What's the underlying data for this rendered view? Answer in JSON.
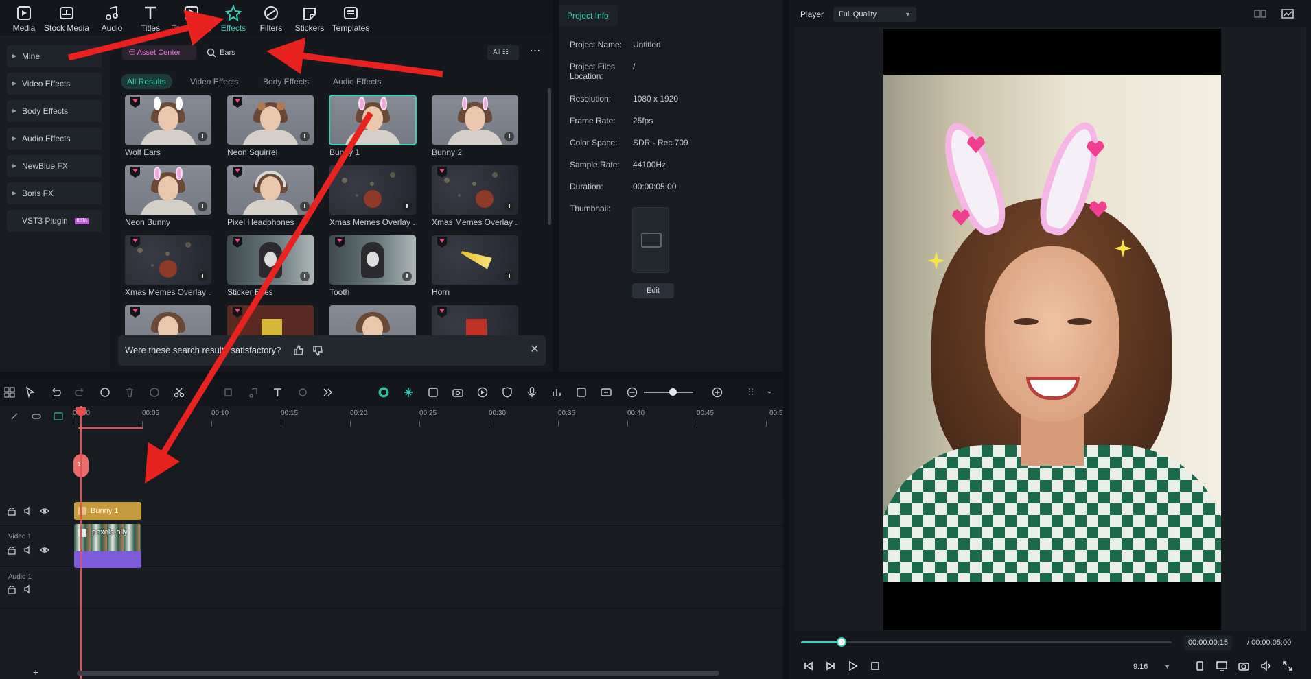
{
  "toolbar": {
    "items": [
      {
        "label": "Media",
        "icon": "media-icon"
      },
      {
        "label": "Stock Media",
        "icon": "stock-media-icon"
      },
      {
        "label": "Audio",
        "icon": "audio-icon"
      },
      {
        "label": "Titles",
        "icon": "titles-icon"
      },
      {
        "label": "Transitions",
        "icon": "transitions-icon"
      },
      {
        "label": "Effects",
        "icon": "effects-icon",
        "active": true
      },
      {
        "label": "Filters",
        "icon": "filters-icon"
      },
      {
        "label": "Stickers",
        "icon": "stickers-icon"
      },
      {
        "label": "Templates",
        "icon": "templates-icon"
      }
    ]
  },
  "sidebar": {
    "items": [
      {
        "label": "Mine"
      },
      {
        "label": "Video Effects"
      },
      {
        "label": "Body Effects"
      },
      {
        "label": "Audio Effects"
      },
      {
        "label": "NewBlue FX"
      },
      {
        "label": "Boris FX"
      },
      {
        "label": "VST3 Plugin",
        "badge": "BETA"
      }
    ]
  },
  "browser": {
    "asset_center_label": "Asset Center",
    "search_value": "Ears",
    "filter_label": "All",
    "result_tabs": [
      "All Results",
      "Video Effects",
      "Body Effects",
      "Audio Effects"
    ],
    "active_tab": "All Results",
    "items": [
      {
        "name": "Wolf Ears",
        "selected": false
      },
      {
        "name": "Neon Squirrel",
        "selected": false
      },
      {
        "name": "Bunny 1",
        "selected": true
      },
      {
        "name": "Bunny 2",
        "selected": false
      },
      {
        "name": "Neon Bunny",
        "selected": false
      },
      {
        "name": "Pixel Headphones",
        "selected": false
      },
      {
        "name": "Xmas Memes Overlay ...",
        "selected": false
      },
      {
        "name": "Xmas Memes Overlay ...",
        "selected": false
      },
      {
        "name": "Xmas Memes Overlay ...",
        "selected": false
      },
      {
        "name": "Sticker Eyes",
        "selected": false
      },
      {
        "name": "Tooth",
        "selected": false
      },
      {
        "name": "Horn",
        "selected": false
      }
    ],
    "feedback": {
      "question": "Were these search results satisfactory?"
    }
  },
  "project_info": {
    "tab_label": "Project Info",
    "rows": [
      {
        "key": "Project Name:",
        "value": "Untitled"
      },
      {
        "key": "Project Files Location:",
        "value": "/"
      },
      {
        "key": "Resolution:",
        "value": "1080 x 1920"
      },
      {
        "key": "Frame Rate:",
        "value": "25fps"
      },
      {
        "key": "Color Space:",
        "value": "SDR - Rec.709"
      },
      {
        "key": "Sample Rate:",
        "value": "44100Hz"
      },
      {
        "key": "Duration:",
        "value": "00:00:05:00"
      },
      {
        "key": "Thumbnail:",
        "value": ""
      }
    ],
    "edit_label": "Edit"
  },
  "player": {
    "label": "Player",
    "quality": "Full Quality",
    "current_time": "00:00:00:15",
    "total_time": "/ 00:00:05:00",
    "ratio": "9:16",
    "progress": 0.11
  },
  "timeline": {
    "ruler_labels": [
      "00:00",
      "00:05",
      "00:10",
      "00:15",
      "00:20",
      "00:25",
      "00:30",
      "00:35",
      "00:40",
      "00:45",
      "00:5"
    ],
    "tracks": [
      {
        "name": ""
      },
      {
        "name": "Video 1"
      },
      {
        "name": "Audio 1"
      }
    ],
    "effect_clip": "Bunny 1",
    "video_clip": "pexels-olly"
  },
  "colors": {
    "accent": "#39d0b8",
    "pin": "#ec4e86",
    "playhead": "#ec4e4e",
    "annotation": "#e8221e"
  }
}
